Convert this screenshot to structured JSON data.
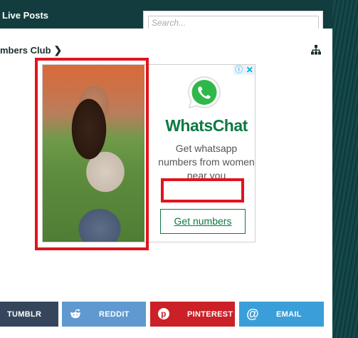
{
  "header": {
    "live_posts_label": "Live Posts",
    "search_placeholder": "Search..."
  },
  "breadcrumb": {
    "label": "mbers Club"
  },
  "ad": {
    "title": "WhatsChat",
    "description": "Get whatsapp numbers from women near you",
    "cta": "Get numbers",
    "info_icon": "info-icon",
    "close_icon": "close-icon",
    "brand_color": "#0c7a43"
  },
  "annotation_color": "#e0141e",
  "share": {
    "buttons": [
      {
        "label": "TUMBLR",
        "color": "#35465c"
      },
      {
        "label": "REDDIT",
        "icon": "reddit-icon",
        "color": "#5f99cf"
      },
      {
        "label": "PINTEREST",
        "icon": "pinterest-icon",
        "color": "#cb2027"
      },
      {
        "label": "EMAIL",
        "icon": "at-icon",
        "color": "#3a9fd8"
      }
    ]
  }
}
